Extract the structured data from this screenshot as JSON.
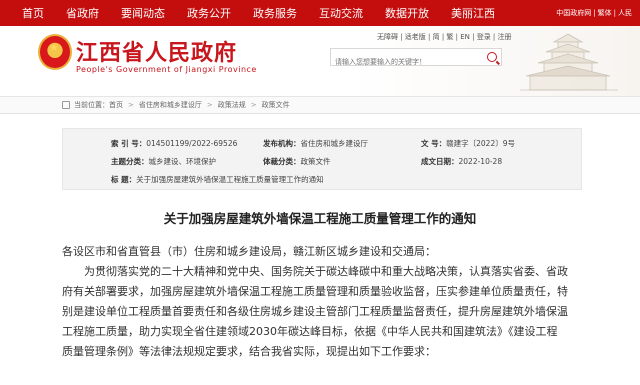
{
  "topnav": {
    "items": [
      "首页",
      "省政府",
      "要闻动态",
      "政务公开",
      "政务服务",
      "互动交流",
      "数据开放",
      "美丽江西"
    ],
    "right_links": [
      "中国政府网",
      "繁体",
      "人民"
    ],
    "right_separators": [
      "|",
      "|"
    ]
  },
  "header": {
    "title": "江西省人民政府",
    "subtitle": "People's Government of Jiangxi Province",
    "top_links": "无障碍 | 适老版 | 简 | 繁 | EN | 登录 | 注册",
    "search_placeholder": "请输入您想要输入的关键字！"
  },
  "breadcrumb": {
    "label": "当前位置：",
    "items": [
      "首页",
      "省住房和城乡建设厅",
      "政策法规",
      "政策文件"
    ],
    "separator": ">"
  },
  "meta": {
    "index_label": "索 引 号：",
    "index_value": "014501199/2022-69526",
    "publisher_label": "发布机构：",
    "publisher_value": "省住房和城乡建设厅",
    "docno_label": "文 号：",
    "docno_value": "赣建字〔2022〕9号",
    "topic_label": "主题分类：",
    "topic_value": "城乡建设、环境保护",
    "type_label": "体裁分类：",
    "type_value": "政策文件",
    "date_label": "成文日期：",
    "date_value": "2022-10-28",
    "title_label": "标 题：",
    "title_value": "关于加强房屋建筑外墙保温工程施工质量管理工作的通知"
  },
  "doc": {
    "title": "关于加强房屋建筑外墙保温工程施工质量管理工作的通知",
    "lines": [
      "各设区市和省直管县（市）住房和城乡建设局，赣江新区城乡建设和交通局：",
      "　　为贯彻落实党的二十大精神和党中央、国务院关于碳达峰碳中和重大战略决策，认真落实省委、省政",
      "府有关部署要求，加强房屋建筑外墙保温工程施工质量管理和质量验收监督，压实参建单位质量责任，特",
      "别是建设单位工程质量首要责任和各级住房城乡建设主管部门工程质量监督责任，提升房屋建筑外墙保温",
      "工程施工质量，助力实现全省住建领域2030年碳达峰目标，依据《中华人民共和国建筑法》《建设工程",
      "质量管理条例》等法律法规规定要求，结合我省实际，现提出如下工作要求："
    ]
  },
  "colors": {
    "brand_red": "#c40d0d",
    "title_red": "#c8161d"
  }
}
